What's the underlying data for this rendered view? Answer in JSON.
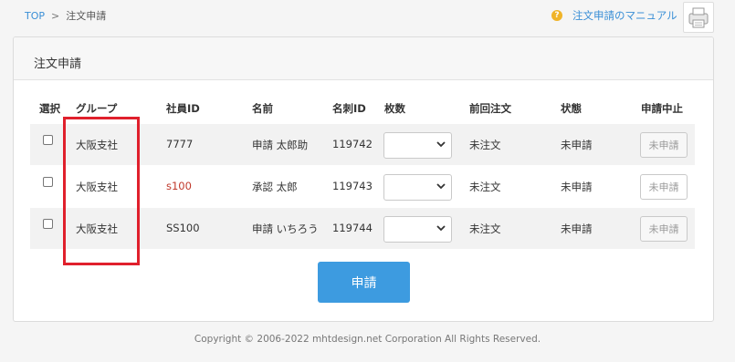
{
  "breadcrumb": {
    "top": "TOP",
    "separator": ">",
    "current": "注文申請"
  },
  "manual": {
    "help_glyph": "?",
    "link": "注文申請のマニュアル"
  },
  "panel": {
    "title": "注文申請"
  },
  "table": {
    "headers": [
      "選択",
      "グループ",
      "社員ID",
      "名前",
      "名刺ID",
      "枚数",
      "前回注文",
      "状態",
      "申請中止"
    ],
    "rows": [
      {
        "group": "大阪支社",
        "employee_id": "7777",
        "employee_id_color": "#333333",
        "name": "申請 太郎助",
        "card_id": "119742",
        "quantity": "",
        "last_order": "未注文",
        "status": "未申請",
        "stop_label": "未申請"
      },
      {
        "group": "大阪支社",
        "employee_id": "s100",
        "employee_id_color": "#c0392b",
        "name": "承認 太郎",
        "card_id": "119743",
        "quantity": "",
        "last_order": "未注文",
        "status": "未申請",
        "stop_label": "未申請"
      },
      {
        "group": "大阪支社",
        "employee_id": "SS100",
        "employee_id_color": "#333333",
        "name": "申請 いちろう",
        "card_id": "119744",
        "quantity": "",
        "last_order": "未注文",
        "status": "未申請",
        "stop_label": "未申請"
      }
    ]
  },
  "submit_label": "申請",
  "footer": "Copyright © 2006-2022 mhtdesign.net Corporation All Rights Reserved.",
  "colors": {
    "accent": "#3d9be0",
    "link": "#3a8fd6",
    "highlight": "#e0202c"
  }
}
